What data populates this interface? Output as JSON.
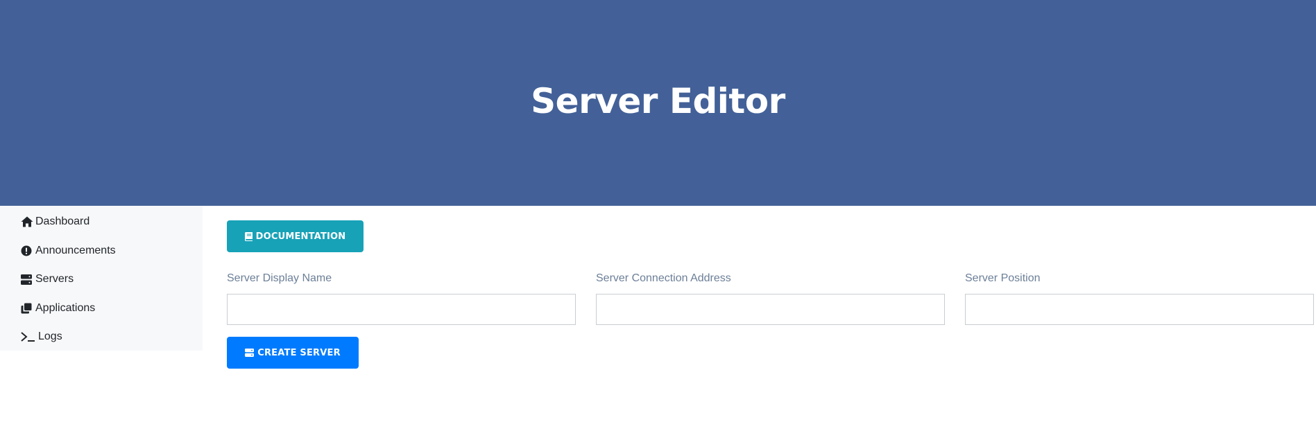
{
  "colors": {
    "hero_background": "#436198",
    "docs_button": "#17a2b8",
    "create_button": "#007bff"
  },
  "hero": {
    "title": "Server Editor"
  },
  "sidebar": {
    "items": [
      {
        "label": "Dashboard",
        "icon": "home-icon"
      },
      {
        "label": "Announcements",
        "icon": "exclamation-circle-icon"
      },
      {
        "label": "Servers",
        "icon": "server-icon"
      },
      {
        "label": "Applications",
        "icon": "clone-icon"
      },
      {
        "label": "Logs",
        "icon": "terminal-icon"
      }
    ]
  },
  "main": {
    "documentation_button": {
      "label": "DOCUMENTATION",
      "icon": "book-icon"
    },
    "fields": [
      {
        "label": "Server Display Name",
        "value": "",
        "placeholder": ""
      },
      {
        "label": "Server Connection Address",
        "value": "",
        "placeholder": ""
      },
      {
        "label": "Server Position",
        "value": "",
        "placeholder": ""
      }
    ],
    "create_button": {
      "label": "CREATE SERVER",
      "icon": "server-icon"
    }
  }
}
